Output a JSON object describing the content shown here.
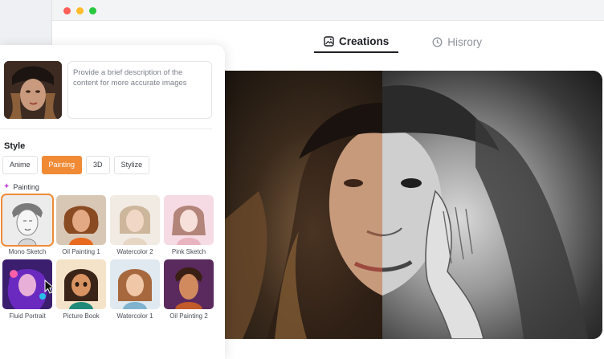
{
  "window": {
    "tabs": [
      {
        "label": "Creations",
        "icon": "image-icon",
        "active": true
      },
      {
        "label": "Hisrory",
        "icon": "clock-icon",
        "active": false
      }
    ]
  },
  "panel": {
    "description_placeholder": "Provide a brief description of the content for more accurate images",
    "style_heading": "Style",
    "style_chips": [
      "Anime",
      "Painting",
      "3D",
      "Stylize"
    ],
    "active_chip": "Painting",
    "sub_heading": "Painting",
    "styles": [
      {
        "label": "Mono Sketch",
        "selected": true
      },
      {
        "label": "Oil Painting 1",
        "selected": false
      },
      {
        "label": "Watercolor 2",
        "selected": false
      },
      {
        "label": "Pink Sketch",
        "selected": false
      },
      {
        "label": "Fluid Portrait",
        "selected": false
      },
      {
        "label": "Picture Book",
        "selected": false
      },
      {
        "label": "Watercolor 1",
        "selected": false
      },
      {
        "label": "Oil Painting 2",
        "selected": false
      }
    ]
  },
  "colors": {
    "accent": "#f08a35",
    "traffic_red": "#fe5f57",
    "traffic_yellow": "#febc2e",
    "traffic_green": "#28c840"
  }
}
